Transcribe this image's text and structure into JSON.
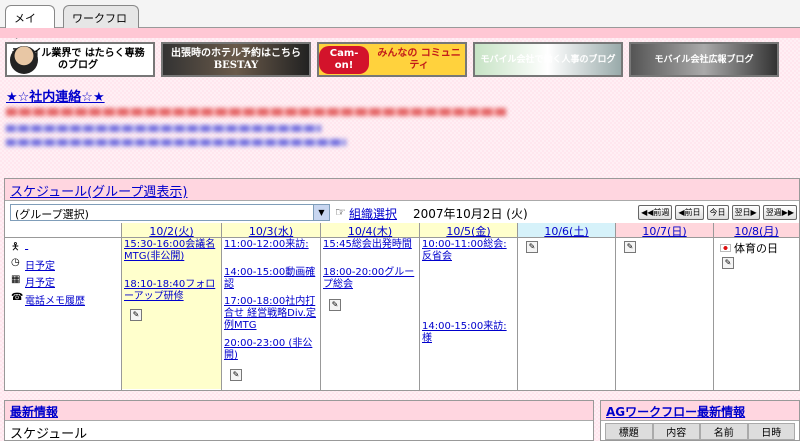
{
  "tabs": [
    {
      "label": "メイン"
    },
    {
      "label": "ワークフロー"
    }
  ],
  "banners": [
    {
      "text": "モバイル業界で はたらく専務のブログ"
    },
    {
      "text": "出張時のホテル予約はこちら BESTAY"
    },
    {
      "logo": "Cam-on!",
      "text": "みんなの コミュニティ"
    },
    {
      "text": "モバイル会社で働く人事のブログ"
    },
    {
      "text": "モバイル会社広報ブログ"
    }
  ],
  "notice": {
    "title": "★☆社内連絡☆★"
  },
  "schedule": {
    "title": "スケジュール(グループ週表示)",
    "group_select": "(グループ選択)",
    "group_link": "組織選択",
    "current_date": "2007年10月2日 (火)",
    "nav": {
      "prev_week": "前週",
      "prev_day": "前日",
      "today": "今日",
      "next_day": "翌日",
      "next_week": "翌週"
    },
    "side_links": {
      "day": "日予定",
      "month": "月予定",
      "memo": "電話メモ履歴"
    },
    "days": [
      {
        "label": "10/2(火)",
        "events": [
          "15:30-16:00会議名 MTG(非公開)",
          "18:10-18:40フォローアップ研修"
        ]
      },
      {
        "label": "10/3(水)",
        "events": [
          "11:00-12:00来訪:",
          "14:00-15:00動画確認",
          "17:00-18:00社内打合せ 経営戦略Div.定例MTG",
          "20:00-23:00 (非公開)"
        ]
      },
      {
        "label": "10/4(木)",
        "events": [
          "15:45総会出発時間",
          "18:00-20:00グループ総会"
        ]
      },
      {
        "label": "10/5(金)",
        "events": [
          "10:00-11:00総会:反省会",
          "14:00-15:00来訪: 様"
        ]
      },
      {
        "label": "10/6(土)",
        "events": []
      },
      {
        "label": "10/7(日)",
        "events": []
      },
      {
        "label": "10/8(月)",
        "events": [],
        "holiday": "体育の日"
      }
    ]
  },
  "news": {
    "title": "最新情報",
    "subtitle": "スケジュール"
  },
  "ag": {
    "title": "AGワークフロー最新情報",
    "columns": [
      "標題",
      "内容",
      "名前",
      "日時"
    ]
  }
}
